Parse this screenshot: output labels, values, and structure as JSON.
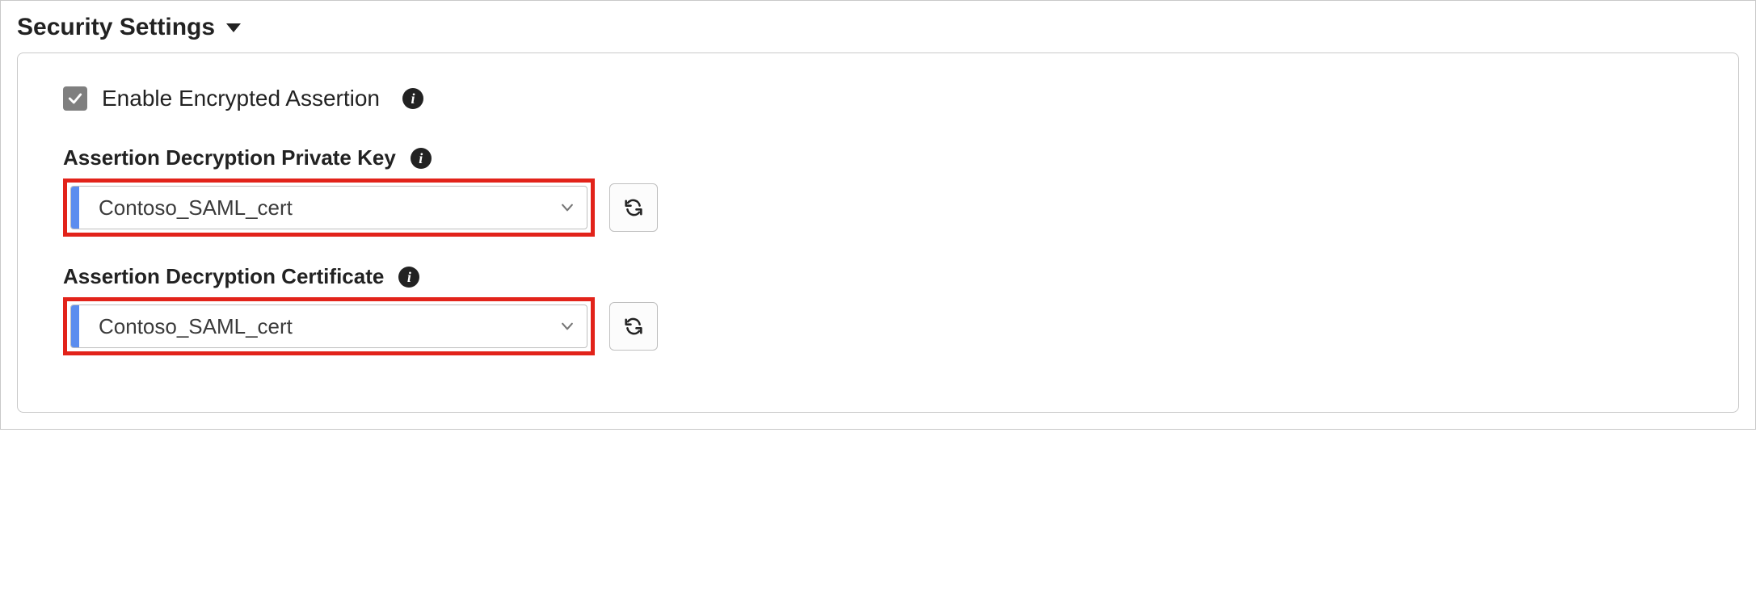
{
  "section": {
    "title": "Security Settings"
  },
  "checkbox": {
    "label": "Enable Encrypted Assertion",
    "checked": true
  },
  "fields": {
    "privateKey": {
      "label": "Assertion Decryption Private Key",
      "value": "Contoso_SAML_cert"
    },
    "certificate": {
      "label": "Assertion Decryption Certificate",
      "value": "Contoso_SAML_cert"
    }
  },
  "colors": {
    "highlight": "#e2231a",
    "accent": "#5b8def",
    "checkbox": "#7f7f7f"
  }
}
